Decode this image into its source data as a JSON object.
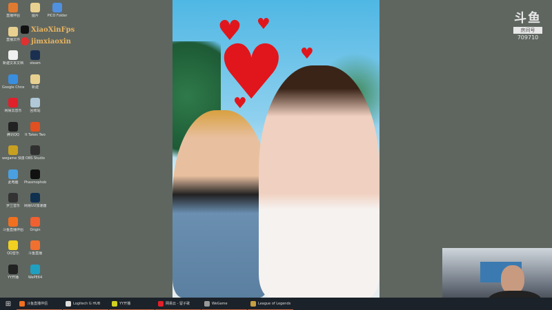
{
  "desktop": {
    "icons": [
      {
        "label": "直播伴侣",
        "color": "#e07a30",
        "col": 0,
        "row": 0
      },
      {
        "label": "直播文件",
        "color": "#e8d090",
        "col": 0,
        "row": 1
      },
      {
        "label": "新建文本文档",
        "color": "#f0f0f0",
        "col": 0,
        "row": 2
      },
      {
        "label": "Google Chrome",
        "color": "#3a8ee0",
        "col": 0,
        "row": 3
      },
      {
        "label": "网易云音乐",
        "color": "#e0202a",
        "col": 0,
        "row": 4
      },
      {
        "label": "腾讯QQ",
        "color": "#222",
        "col": 0,
        "row": 5
      },
      {
        "label": "wegame 快捷方式",
        "color": "#c8a020",
        "col": 0,
        "row": 6
      },
      {
        "label": "此电脑",
        "color": "#4aa0e0",
        "col": 0,
        "row": 7
      },
      {
        "label": "罗兰音乐",
        "color": "#333",
        "col": 0,
        "row": 8
      },
      {
        "label": "斗鱼直播伴侣",
        "color": "#f07020",
        "col": 0,
        "row": 9
      },
      {
        "label": "QQ音乐",
        "color": "#f0d020",
        "col": 0,
        "row": 10
      },
      {
        "label": "YY开播",
        "color": "#222",
        "col": 0,
        "row": 11
      },
      {
        "label": "图片",
        "color": "#e8d090",
        "col": 1,
        "row": 0
      },
      {
        "label": "steam",
        "color": "#1b3050",
        "col": 1,
        "row": 2
      },
      {
        "label": "新建",
        "color": "#e8d090",
        "col": 1,
        "row": 3
      },
      {
        "label": "回收站",
        "color": "#b0c8d8",
        "col": 1,
        "row": 4
      },
      {
        "label": "It Takes Two",
        "color": "#e05020",
        "col": 1,
        "row": 5
      },
      {
        "label": "OBS Studio",
        "color": "#303030",
        "col": 1,
        "row": 6
      },
      {
        "label": "Phasmophobia",
        "color": "#111",
        "col": 1,
        "row": 7
      },
      {
        "label": "网易UU加速器",
        "color": "#103050",
        "col": 1,
        "row": 8
      },
      {
        "label": "Origin",
        "color": "#f06030",
        "col": 1,
        "row": 9
      },
      {
        "label": "斗鱼直播",
        "color": "#f07030",
        "col": 1,
        "row": 10
      },
      {
        "label": "WePE64",
        "color": "#20a0c0",
        "col": 1,
        "row": 11
      },
      {
        "label": "PICO Folder",
        "color": "#5090e0",
        "col": 2,
        "row": 0
      }
    ]
  },
  "overlay": {
    "douyin": "XiaoXinFps",
    "weibo": "jimxiaoxin"
  },
  "logo": {
    "mark": "斗鱼",
    "room_label": "房间号",
    "room_number": "709710"
  },
  "taskbar": {
    "items": [
      {
        "label": "斗鱼直播伴侣",
        "color": "#f07020"
      },
      {
        "label": "Logitech G HUB",
        "color": "#ddd"
      },
      {
        "label": "YY开播",
        "color": "#d0d020"
      },
      {
        "label": "网易云 - 留子歌",
        "color": "#e0202a"
      },
      {
        "label": "WeGame",
        "color": "#999"
      },
      {
        "label": "League of Legends",
        "color": "#c8a040"
      }
    ]
  }
}
